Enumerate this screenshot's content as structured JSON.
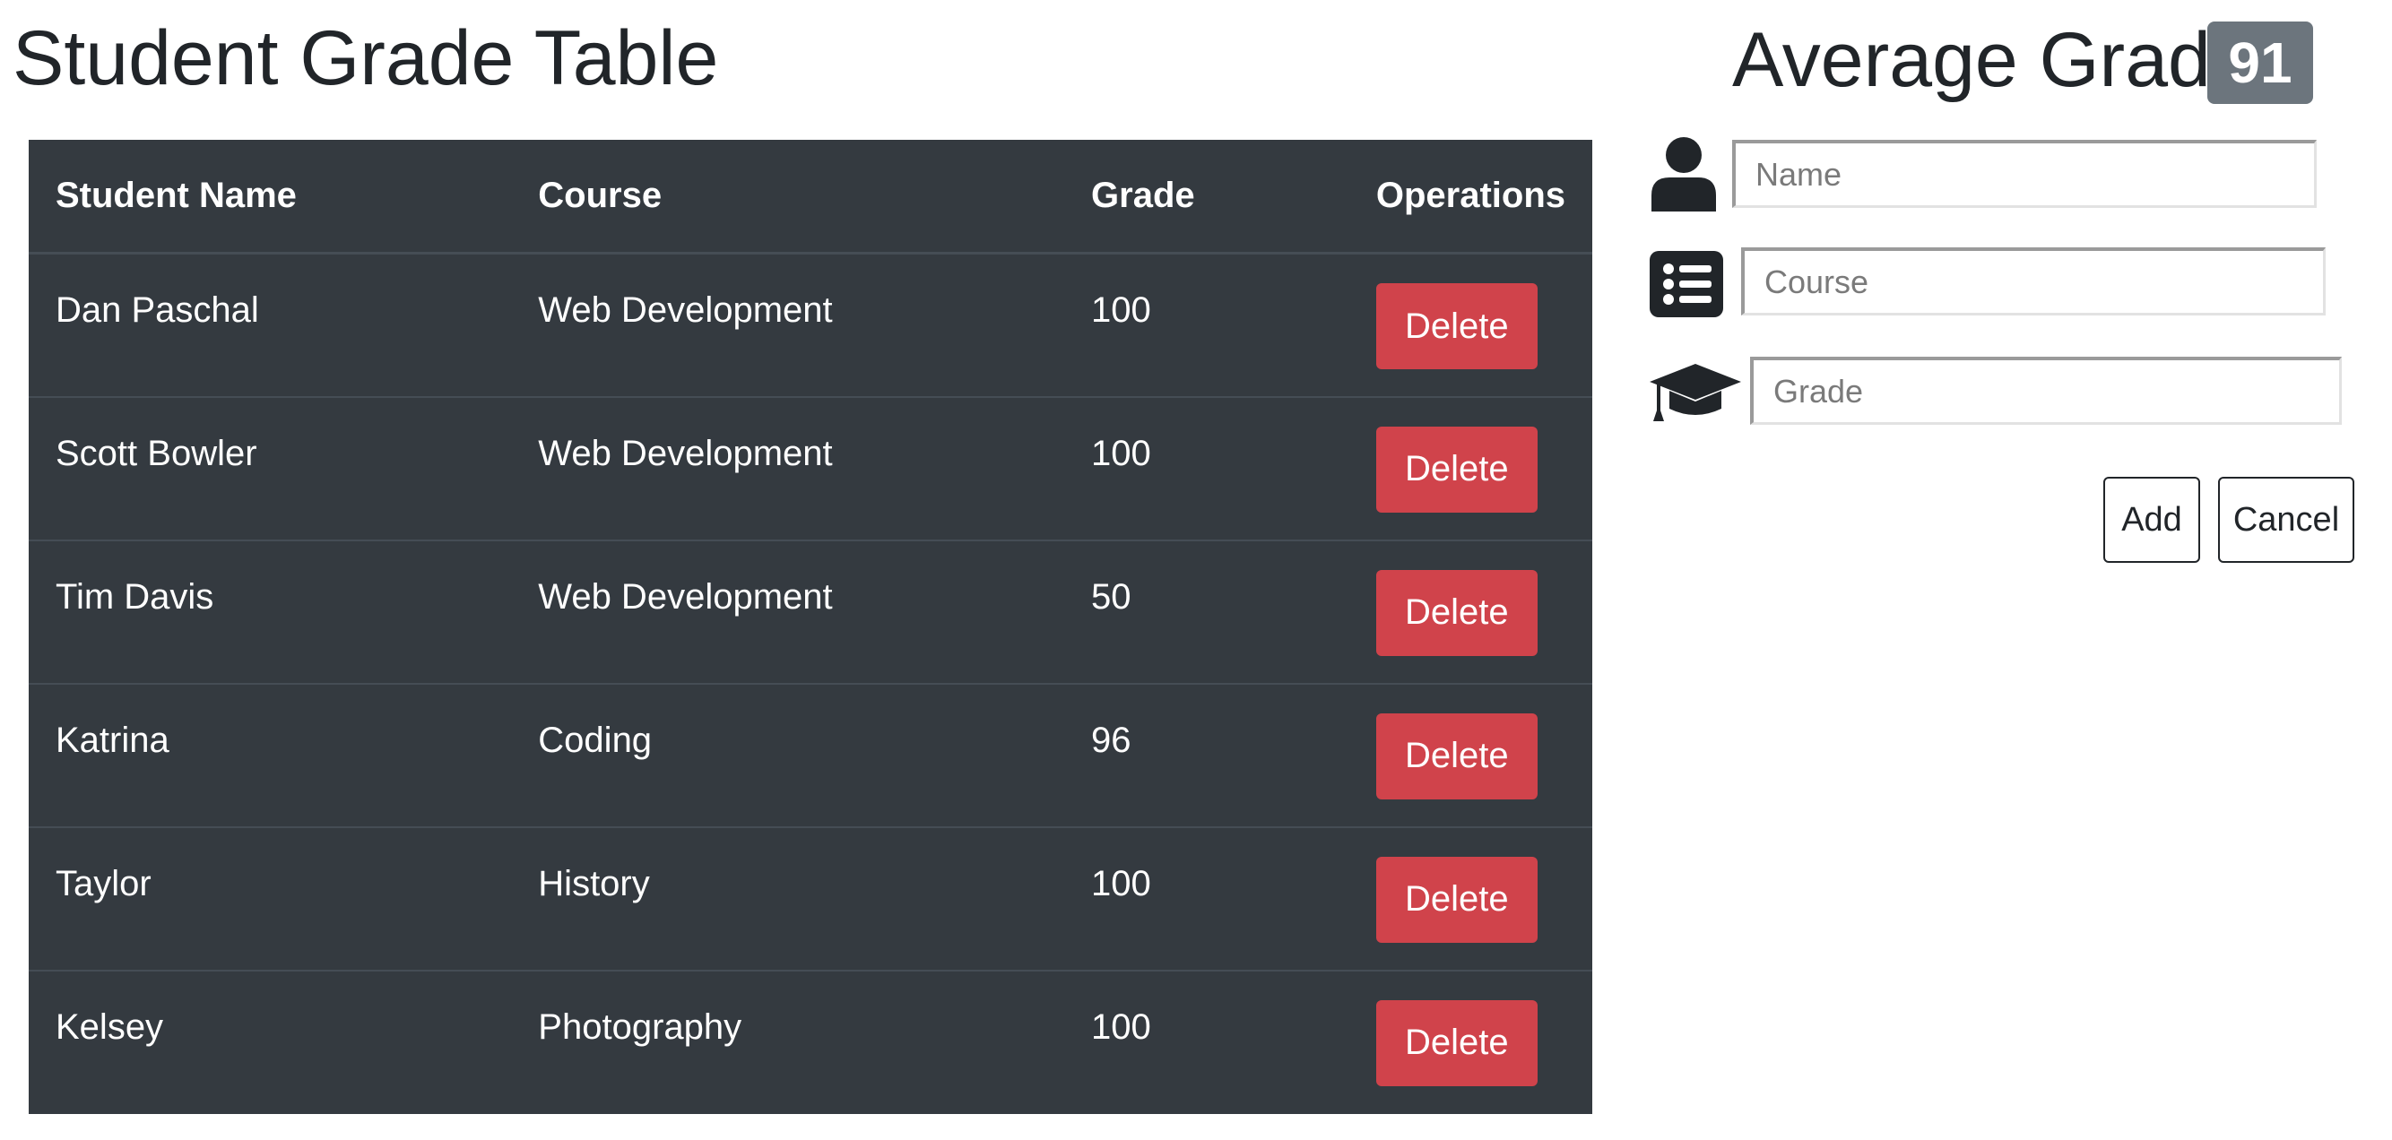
{
  "page_title": "Student Grade Table",
  "table": {
    "headers": {
      "name": "Student Name",
      "course": "Course",
      "grade": "Grade",
      "operations": "Operations"
    },
    "rows": [
      {
        "name": "Dan Paschal",
        "course": "Web Development",
        "grade": "100",
        "delete_label": "Delete"
      },
      {
        "name": "Scott Bowler",
        "course": "Web Development",
        "grade": "100",
        "delete_label": "Delete"
      },
      {
        "name": "Tim Davis",
        "course": "Web Development",
        "grade": "50",
        "delete_label": "Delete"
      },
      {
        "name": "Katrina",
        "course": "Coding",
        "grade": "96",
        "delete_label": "Delete"
      },
      {
        "name": "Taylor",
        "course": "History",
        "grade": "100",
        "delete_label": "Delete"
      },
      {
        "name": "Kelsey",
        "course": "Photography",
        "grade": "100",
        "delete_label": "Delete"
      }
    ]
  },
  "average": {
    "label": "Average Grade",
    "value": "91"
  },
  "form": {
    "name_placeholder": "Name",
    "course_placeholder": "Course",
    "grade_placeholder": "Grade",
    "name_icon": "user-icon",
    "course_icon": "list-icon",
    "grade_icon": "graduation-cap-icon",
    "add_label": "Add",
    "cancel_label": "Cancel"
  },
  "colors": {
    "table_bg": "#343a40",
    "delete_button": "#d0434b",
    "badge_bg": "#6c757d",
    "text_dark": "#212529"
  }
}
